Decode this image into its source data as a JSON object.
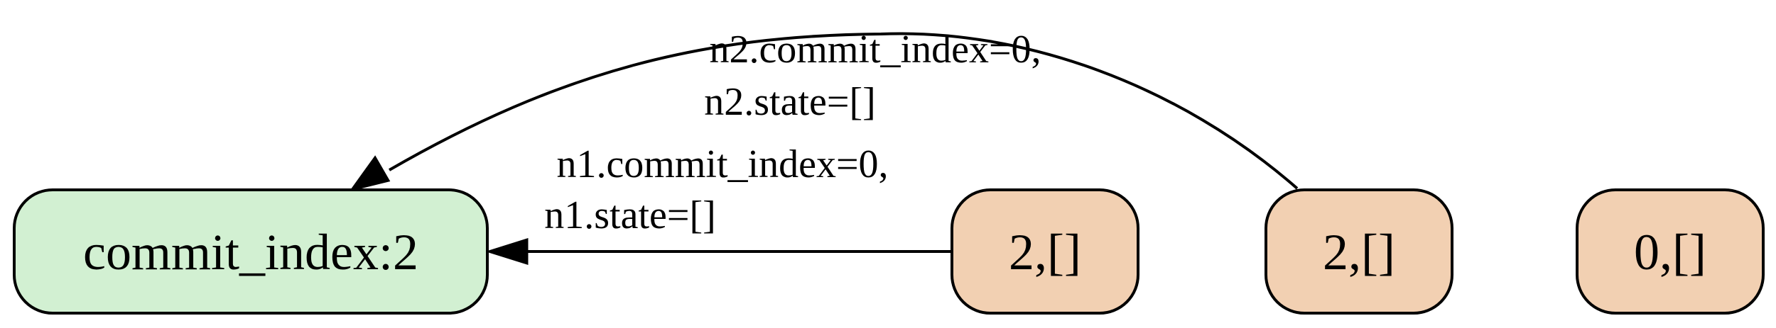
{
  "nodes": [
    {
      "id": "commit",
      "label": "commit_index:2",
      "fill": "#d2f0d2"
    },
    {
      "id": "n1",
      "label": "2,[]",
      "fill": "#f2d0b2"
    },
    {
      "id": "n2",
      "label": "2,[]",
      "fill": "#f2d0b2"
    },
    {
      "id": "n3",
      "label": "0,[]",
      "fill": "#f2d0b2"
    }
  ],
  "edges": [
    {
      "from": "n2",
      "to": "commit",
      "label_lines": [
        "n2.commit_index=0,",
        "n2.state=[]"
      ]
    },
    {
      "from": "n1",
      "to": "commit",
      "label_lines": [
        "n1.commit_index=0,",
        "n1.state=[]"
      ]
    }
  ],
  "colors": {
    "stroke": "#000000",
    "text": "#000000"
  }
}
